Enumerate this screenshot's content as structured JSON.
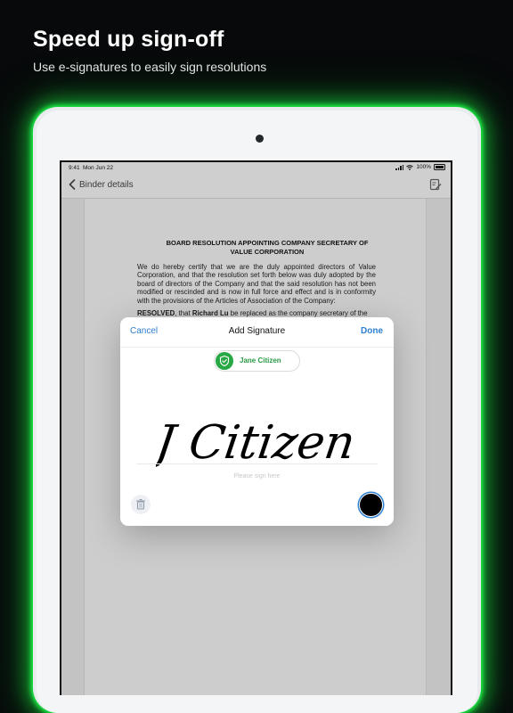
{
  "promo": {
    "headline": "Speed up sign-off",
    "subline": "Use e-signatures to easily sign resolutions"
  },
  "status_bar": {
    "time": "9:41",
    "date": "Mon Jun 22",
    "battery": "100%"
  },
  "nav": {
    "back_label": "Binder details",
    "edit_icon": "edit-document-icon"
  },
  "document": {
    "title_line1": "BOARD RESOLUTION APPOINTING COMPANY SECRETARY OF",
    "title_line2": "VALUE CORPORATION",
    "body": "We do hereby certify that we are the duly appointed directors of Value Corporation, and that the resolution set forth below was duly adopted by the board of directors of the Company and that the said resolution has not been modified or rescinded and is now in full force and effect and is in conformity with the provisions of the Articles of Association of the Company:",
    "resolved_label": "RESOLVED",
    "resolved_text_1": ", that ",
    "resolved_name": "Richard Lu",
    "resolved_text_2": " be replaced as the company secretary of the"
  },
  "signature_modal": {
    "cancel_label": "Cancel",
    "title": "Add Signature",
    "done_label": "Done",
    "signer_name": "Jane Citizen",
    "signature_text": "J Citizen",
    "hint": "Please sign here",
    "pen_color": "#000000",
    "icons": {
      "signer": "shield-check-icon",
      "clear": "trash-icon"
    }
  },
  "colors": {
    "accent": "#2d7fd3",
    "signer_green": "#28a745",
    "glow": "#1fff4a"
  }
}
